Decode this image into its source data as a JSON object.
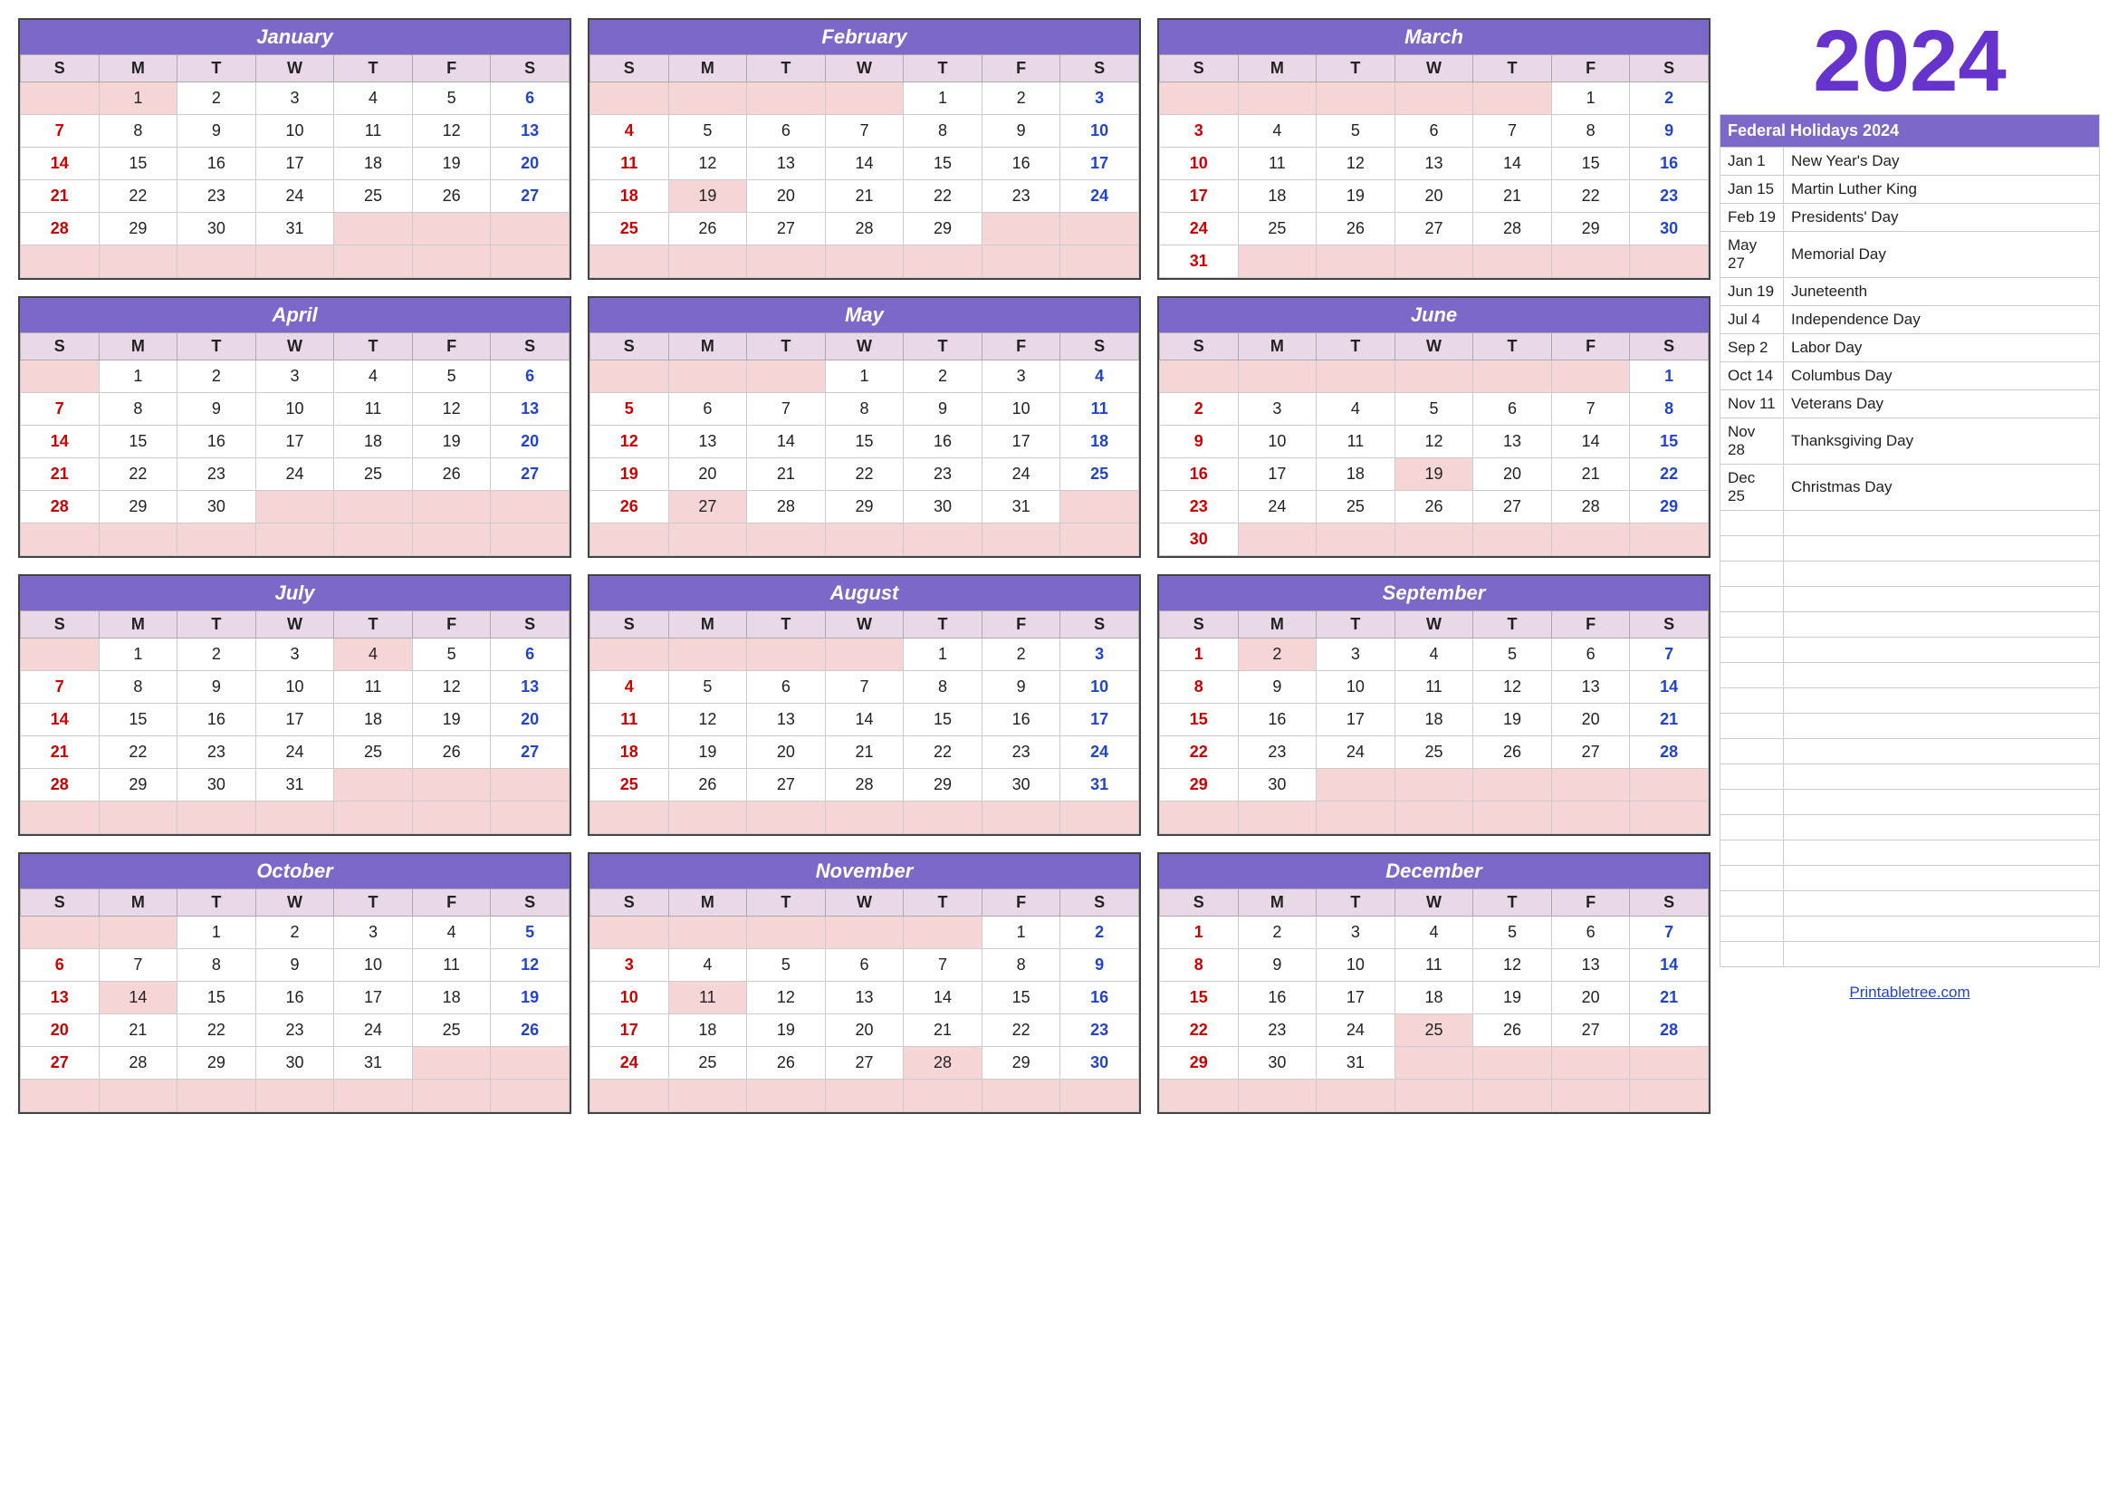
{
  "year": "2024",
  "months": [
    {
      "name": "January",
      "days": [
        [
          "",
          "1",
          "2",
          "3",
          "4",
          "5",
          "6"
        ],
        [
          "7",
          "8",
          "9",
          "10",
          "11",
          "12",
          "13"
        ],
        [
          "14",
          "15",
          "16",
          "17",
          "18",
          "19",
          "20"
        ],
        [
          "21",
          "22",
          "23",
          "24",
          "25",
          "26",
          "27"
        ],
        [
          "28",
          "29",
          "30",
          "31",
          "",
          "",
          ""
        ]
      ],
      "holidays": [
        "1"
      ],
      "sundays": [
        "7",
        "14",
        "21",
        "28"
      ],
      "saturdays": [
        "6",
        "13",
        "20",
        "27"
      ]
    },
    {
      "name": "February",
      "days": [
        [
          "",
          "",
          "",
          "",
          "1",
          "2",
          "3"
        ],
        [
          "4",
          "5",
          "6",
          "7",
          "8",
          "9",
          "10"
        ],
        [
          "11",
          "12",
          "13",
          "14",
          "15",
          "16",
          "17"
        ],
        [
          "18",
          "19",
          "20",
          "21",
          "22",
          "23",
          "24"
        ],
        [
          "25",
          "26",
          "27",
          "28",
          "29",
          "",
          ""
        ]
      ],
      "holidays": [
        "19"
      ],
      "sundays": [
        "4",
        "11",
        "18",
        "25"
      ],
      "saturdays": [
        "3",
        "10",
        "17",
        "24"
      ]
    },
    {
      "name": "March",
      "days": [
        [
          "",
          "",
          "",
          "",
          "",
          "1",
          "2"
        ],
        [
          "3",
          "4",
          "5",
          "6",
          "7",
          "8",
          "9"
        ],
        [
          "10",
          "11",
          "12",
          "13",
          "14",
          "15",
          "16"
        ],
        [
          "17",
          "18",
          "19",
          "20",
          "21",
          "22",
          "23"
        ],
        [
          "24",
          "25",
          "26",
          "27",
          "28",
          "29",
          "30"
        ],
        [
          "31",
          "",
          "",
          "",
          "",
          "",
          ""
        ]
      ],
      "holidays": [],
      "sundays": [
        "3",
        "10",
        "17",
        "24",
        "31"
      ],
      "saturdays": [
        "2",
        "9",
        "16",
        "23",
        "30"
      ]
    },
    {
      "name": "April",
      "days": [
        [
          "",
          "1",
          "2",
          "3",
          "4",
          "5",
          "6"
        ],
        [
          "7",
          "8",
          "9",
          "10",
          "11",
          "12",
          "13"
        ],
        [
          "14",
          "15",
          "16",
          "17",
          "18",
          "19",
          "20"
        ],
        [
          "21",
          "22",
          "23",
          "24",
          "25",
          "26",
          "27"
        ],
        [
          "28",
          "29",
          "30",
          "",
          "",
          "",
          ""
        ]
      ],
      "holidays": [],
      "sundays": [
        "7",
        "14",
        "21",
        "28"
      ],
      "saturdays": [
        "6",
        "13",
        "20",
        "27"
      ]
    },
    {
      "name": "May",
      "days": [
        [
          "",
          "",
          "",
          "1",
          "2",
          "3",
          "4"
        ],
        [
          "5",
          "6",
          "7",
          "8",
          "9",
          "10",
          "11"
        ],
        [
          "12",
          "13",
          "14",
          "15",
          "16",
          "17",
          "18"
        ],
        [
          "19",
          "20",
          "21",
          "22",
          "23",
          "24",
          "25"
        ],
        [
          "26",
          "27",
          "28",
          "29",
          "30",
          "31",
          ""
        ]
      ],
      "holidays": [
        "27"
      ],
      "sundays": [
        "5",
        "12",
        "19",
        "26"
      ],
      "saturdays": [
        "4",
        "11",
        "18",
        "25"
      ]
    },
    {
      "name": "June",
      "days": [
        [
          "",
          "",
          "",
          "",
          "",
          "",
          "1"
        ],
        [
          "2",
          "3",
          "4",
          "5",
          "6",
          "7",
          "8"
        ],
        [
          "9",
          "10",
          "11",
          "12",
          "13",
          "14",
          "15"
        ],
        [
          "16",
          "17",
          "18",
          "19",
          "20",
          "21",
          "22"
        ],
        [
          "23",
          "24",
          "25",
          "26",
          "27",
          "28",
          "29"
        ],
        [
          "30",
          "",
          "",
          "",
          "",
          "",
          ""
        ]
      ],
      "holidays": [
        "19"
      ],
      "sundays": [
        "2",
        "9",
        "16",
        "23",
        "30"
      ],
      "saturdays": [
        "1",
        "8",
        "15",
        "22",
        "29"
      ]
    },
    {
      "name": "July",
      "days": [
        [
          "",
          "1",
          "2",
          "3",
          "4",
          "5",
          "6"
        ],
        [
          "7",
          "8",
          "9",
          "10",
          "11",
          "12",
          "13"
        ],
        [
          "14",
          "15",
          "16",
          "17",
          "18",
          "19",
          "20"
        ],
        [
          "21",
          "22",
          "23",
          "24",
          "25",
          "26",
          "27"
        ],
        [
          "28",
          "29",
          "30",
          "31",
          "",
          "",
          ""
        ]
      ],
      "holidays": [
        "4"
      ],
      "sundays": [
        "7",
        "14",
        "21",
        "28"
      ],
      "saturdays": [
        "6",
        "13",
        "20",
        "27"
      ]
    },
    {
      "name": "August",
      "days": [
        [
          "",
          "",
          "",
          "",
          "1",
          "2",
          "3"
        ],
        [
          "4",
          "5",
          "6",
          "7",
          "8",
          "9",
          "10"
        ],
        [
          "11",
          "12",
          "13",
          "14",
          "15",
          "16",
          "17"
        ],
        [
          "18",
          "19",
          "20",
          "21",
          "22",
          "23",
          "24"
        ],
        [
          "25",
          "26",
          "27",
          "28",
          "29",
          "30",
          "31"
        ]
      ],
      "holidays": [],
      "sundays": [
        "4",
        "11",
        "18",
        "25"
      ],
      "saturdays": [
        "3",
        "10",
        "17",
        "24",
        "31"
      ]
    },
    {
      "name": "September",
      "days": [
        [
          "1",
          "2",
          "3",
          "4",
          "5",
          "6",
          "7"
        ],
        [
          "8",
          "9",
          "10",
          "11",
          "12",
          "13",
          "14"
        ],
        [
          "15",
          "16",
          "17",
          "18",
          "19",
          "20",
          "21"
        ],
        [
          "22",
          "23",
          "24",
          "25",
          "26",
          "27",
          "28"
        ],
        [
          "29",
          "30",
          "",
          "",
          "",
          "",
          ""
        ]
      ],
      "holidays": [
        "2"
      ],
      "sundays": [
        "1",
        "8",
        "15",
        "22",
        "29"
      ],
      "saturdays": [
        "7",
        "14",
        "21",
        "28"
      ]
    },
    {
      "name": "October",
      "days": [
        [
          "",
          "",
          "1",
          "2",
          "3",
          "4",
          "5"
        ],
        [
          "6",
          "7",
          "8",
          "9",
          "10",
          "11",
          "12"
        ],
        [
          "13",
          "14",
          "15",
          "16",
          "17",
          "18",
          "19"
        ],
        [
          "20",
          "21",
          "22",
          "23",
          "24",
          "25",
          "26"
        ],
        [
          "27",
          "28",
          "29",
          "30",
          "31",
          "",
          ""
        ]
      ],
      "holidays": [
        "14"
      ],
      "sundays": [
        "6",
        "13",
        "20",
        "27"
      ],
      "saturdays": [
        "5",
        "12",
        "19",
        "26"
      ]
    },
    {
      "name": "November",
      "days": [
        [
          "",
          "",
          "",
          "",
          "",
          "1",
          "2"
        ],
        [
          "3",
          "4",
          "5",
          "6",
          "7",
          "8",
          "9"
        ],
        [
          "10",
          "11",
          "12",
          "13",
          "14",
          "15",
          "16"
        ],
        [
          "17",
          "18",
          "19",
          "20",
          "21",
          "22",
          "23"
        ],
        [
          "24",
          "25",
          "26",
          "27",
          "28",
          "29",
          "30"
        ]
      ],
      "holidays": [
        "11",
        "28"
      ],
      "sundays": [
        "3",
        "10",
        "17",
        "24"
      ],
      "saturdays": [
        "2",
        "9",
        "16",
        "23",
        "30"
      ]
    },
    {
      "name": "December",
      "days": [
        [
          "1",
          "2",
          "3",
          "4",
          "5",
          "6",
          "7"
        ],
        [
          "8",
          "9",
          "10",
          "11",
          "12",
          "13",
          "14"
        ],
        [
          "15",
          "16",
          "17",
          "18",
          "19",
          "20",
          "21"
        ],
        [
          "22",
          "23",
          "24",
          "25",
          "26",
          "27",
          "28"
        ],
        [
          "29",
          "30",
          "31",
          "",
          "",
          "",
          ""
        ]
      ],
      "holidays": [
        "25"
      ],
      "sundays": [
        "1",
        "8",
        "15",
        "22",
        "29"
      ],
      "saturdays": [
        "7",
        "14",
        "21",
        "28"
      ]
    }
  ],
  "day_headers": [
    "S",
    "M",
    "T",
    "W",
    "T",
    "F",
    "S"
  ],
  "holidays_panel": {
    "title": "Federal Holidays 2024",
    "items": [
      {
        "date": "Jan 1",
        "name": "New Year's Day"
      },
      {
        "date": "Jan 15",
        "name": "Martin Luther King"
      },
      {
        "date": "Feb 19",
        "name": "Presidents' Day"
      },
      {
        "date": "May 27",
        "name": "Memorial Day"
      },
      {
        "date": "Jun 19",
        "name": "Juneteenth"
      },
      {
        "date": "Jul 4",
        "name": "Independence Day"
      },
      {
        "date": "Sep 2",
        "name": "Labor Day"
      },
      {
        "date": "Oct 14",
        "name": "Columbus Day"
      },
      {
        "date": "Nov 11",
        "name": "Veterans Day"
      },
      {
        "date": "Nov 28",
        "name": "Thanksgiving Day"
      },
      {
        "date": "Dec 25",
        "name": "Christmas Day"
      }
    ]
  },
  "website": "Printabletree.com"
}
